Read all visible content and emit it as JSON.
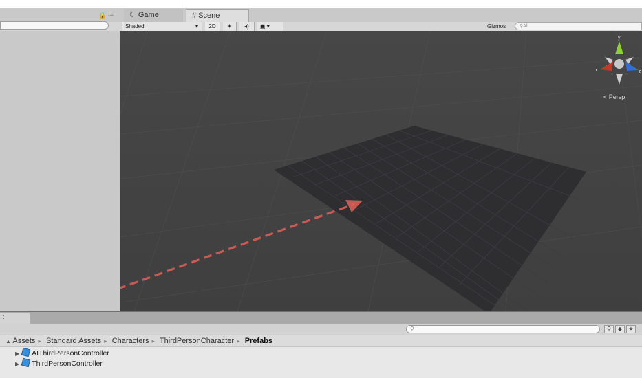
{
  "tabs": {
    "game_label": "Game",
    "scene_label": "Scene"
  },
  "toolbar": {
    "shading_mode": "Shaded",
    "mode_2d_label": "2D",
    "gizmos_label": "Gizmos",
    "search_placeholder": "All"
  },
  "scene": {
    "projection_label": "Persp",
    "axes": {
      "x": "x",
      "y": "y",
      "z": "z"
    },
    "colors": {
      "x_axis": "#c43a2a",
      "y_axis": "#8fd12f",
      "z_axis": "#2f6fd6",
      "annotation_arrow": "#e0605a"
    }
  },
  "project": {
    "breadcrumb": [
      "Assets",
      "Standard Assets",
      "Characters",
      "ThirdPersonCharacter",
      "Prefabs"
    ],
    "items": [
      {
        "label": "AIThirdPersonController"
      },
      {
        "label": "ThirdPersonController"
      }
    ]
  }
}
